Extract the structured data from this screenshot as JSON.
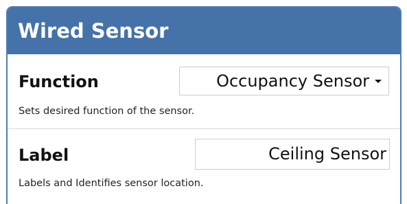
{
  "panel": {
    "title": "Wired Sensor"
  },
  "function_row": {
    "label": "Function",
    "selected_value": "Occupancy Sensor",
    "description": "Sets desired function of the sensor."
  },
  "label_row": {
    "label": "Label",
    "value": "Ceiling Sensor",
    "description": "Labels and Identifies sensor location."
  },
  "icons": {
    "dropdown": "caret-down-icon"
  },
  "colors": {
    "header_background": "#4572a8",
    "header_text": "#ffffff",
    "panel_border": "#4d7cb0"
  }
}
